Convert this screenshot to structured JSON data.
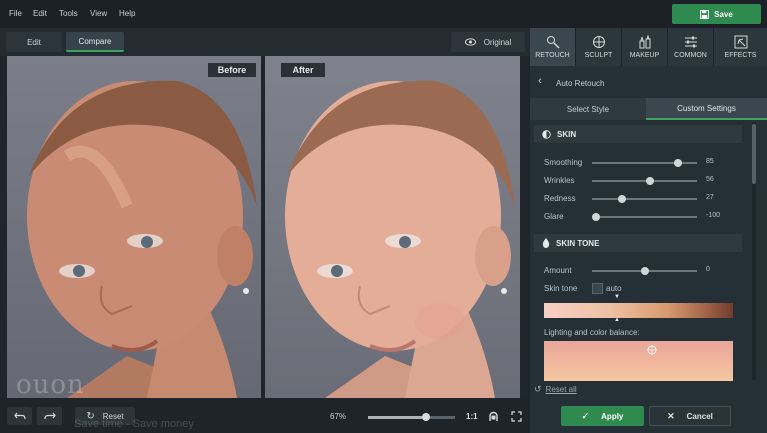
{
  "menu": [
    "File",
    "Edit",
    "Tools",
    "View",
    "Help"
  ],
  "save_label": "Save",
  "view_tabs": {
    "edit": "Edit",
    "compare": "Compare"
  },
  "original_label": "Original",
  "compare": {
    "before": "Before",
    "after": "After"
  },
  "tools": [
    {
      "label": "RETOUCH",
      "icon": "retouch-icon"
    },
    {
      "label": "SCULPT",
      "icon": "sculpt-icon"
    },
    {
      "label": "MAKEUP",
      "icon": "makeup-icon"
    },
    {
      "label": "COMMON",
      "icon": "sliders-icon"
    },
    {
      "label": "EFFECTS",
      "icon": "effects-icon"
    }
  ],
  "panel": {
    "back_title": "Auto Retouch",
    "tabs": {
      "select_style": "Select Style",
      "custom_settings": "Custom Settings"
    },
    "skin": {
      "title": "SKIN",
      "sliders": [
        {
          "label": "Smoothing",
          "value": "85",
          "level": 0.85
        },
        {
          "label": "Wrinkles",
          "value": "56",
          "level": 0.56
        },
        {
          "label": "Redness",
          "value": "27",
          "level": 0.27
        },
        {
          "label": "Glare",
          "value": "-100",
          "level": 0.0
        }
      ]
    },
    "skin_tone": {
      "title": "SKIN TONE",
      "amount_label": "Amount",
      "amount_value": "0",
      "amount_level": 0.5,
      "tone_label": "Skin tone",
      "auto_label": "auto",
      "lighting_label": "Lighting and color balance:"
    },
    "reset_all": "Reset all"
  },
  "bottom": {
    "reset_label": "Reset",
    "zoom": "67%",
    "zoom_level": 0.67,
    "one_to_one": "1:1",
    "apply_label": "Apply",
    "cancel_label": "Cancel"
  },
  "watermark": {
    "logo": "ouon",
    "tagline": "Save time - Save money"
  }
}
